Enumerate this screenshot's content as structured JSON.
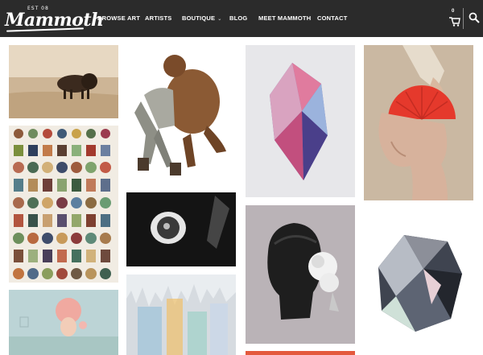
{
  "brand": {
    "logo_word": "Mammoth",
    "logo_est": "EST 08"
  },
  "nav": {
    "items": [
      "BROWSE ART",
      "ARTISTS",
      "BOUTIQUE",
      "BLOG",
      "MEET MAMMOTH",
      "CONTACT"
    ],
    "boutique_caret": "⌄"
  },
  "cart": {
    "count": "0"
  },
  "icons": [
    "cart-icon",
    "search-icon"
  ],
  "colors": {
    "nav_bg": "#2b2b2b",
    "nav_text": "#ffffff",
    "red_fan": "#e5392c"
  },
  "gallery": {
    "artworks": [
      "bison-landscape",
      "bear-hugging-man",
      "pink-crystal",
      "red-fan-woman",
      "gemstones-chart",
      "eye-closeup",
      "black-head-flowers",
      "geometric-crystal",
      "pink-hair-girl",
      "colorful-spikes",
      "red-strip"
    ]
  }
}
